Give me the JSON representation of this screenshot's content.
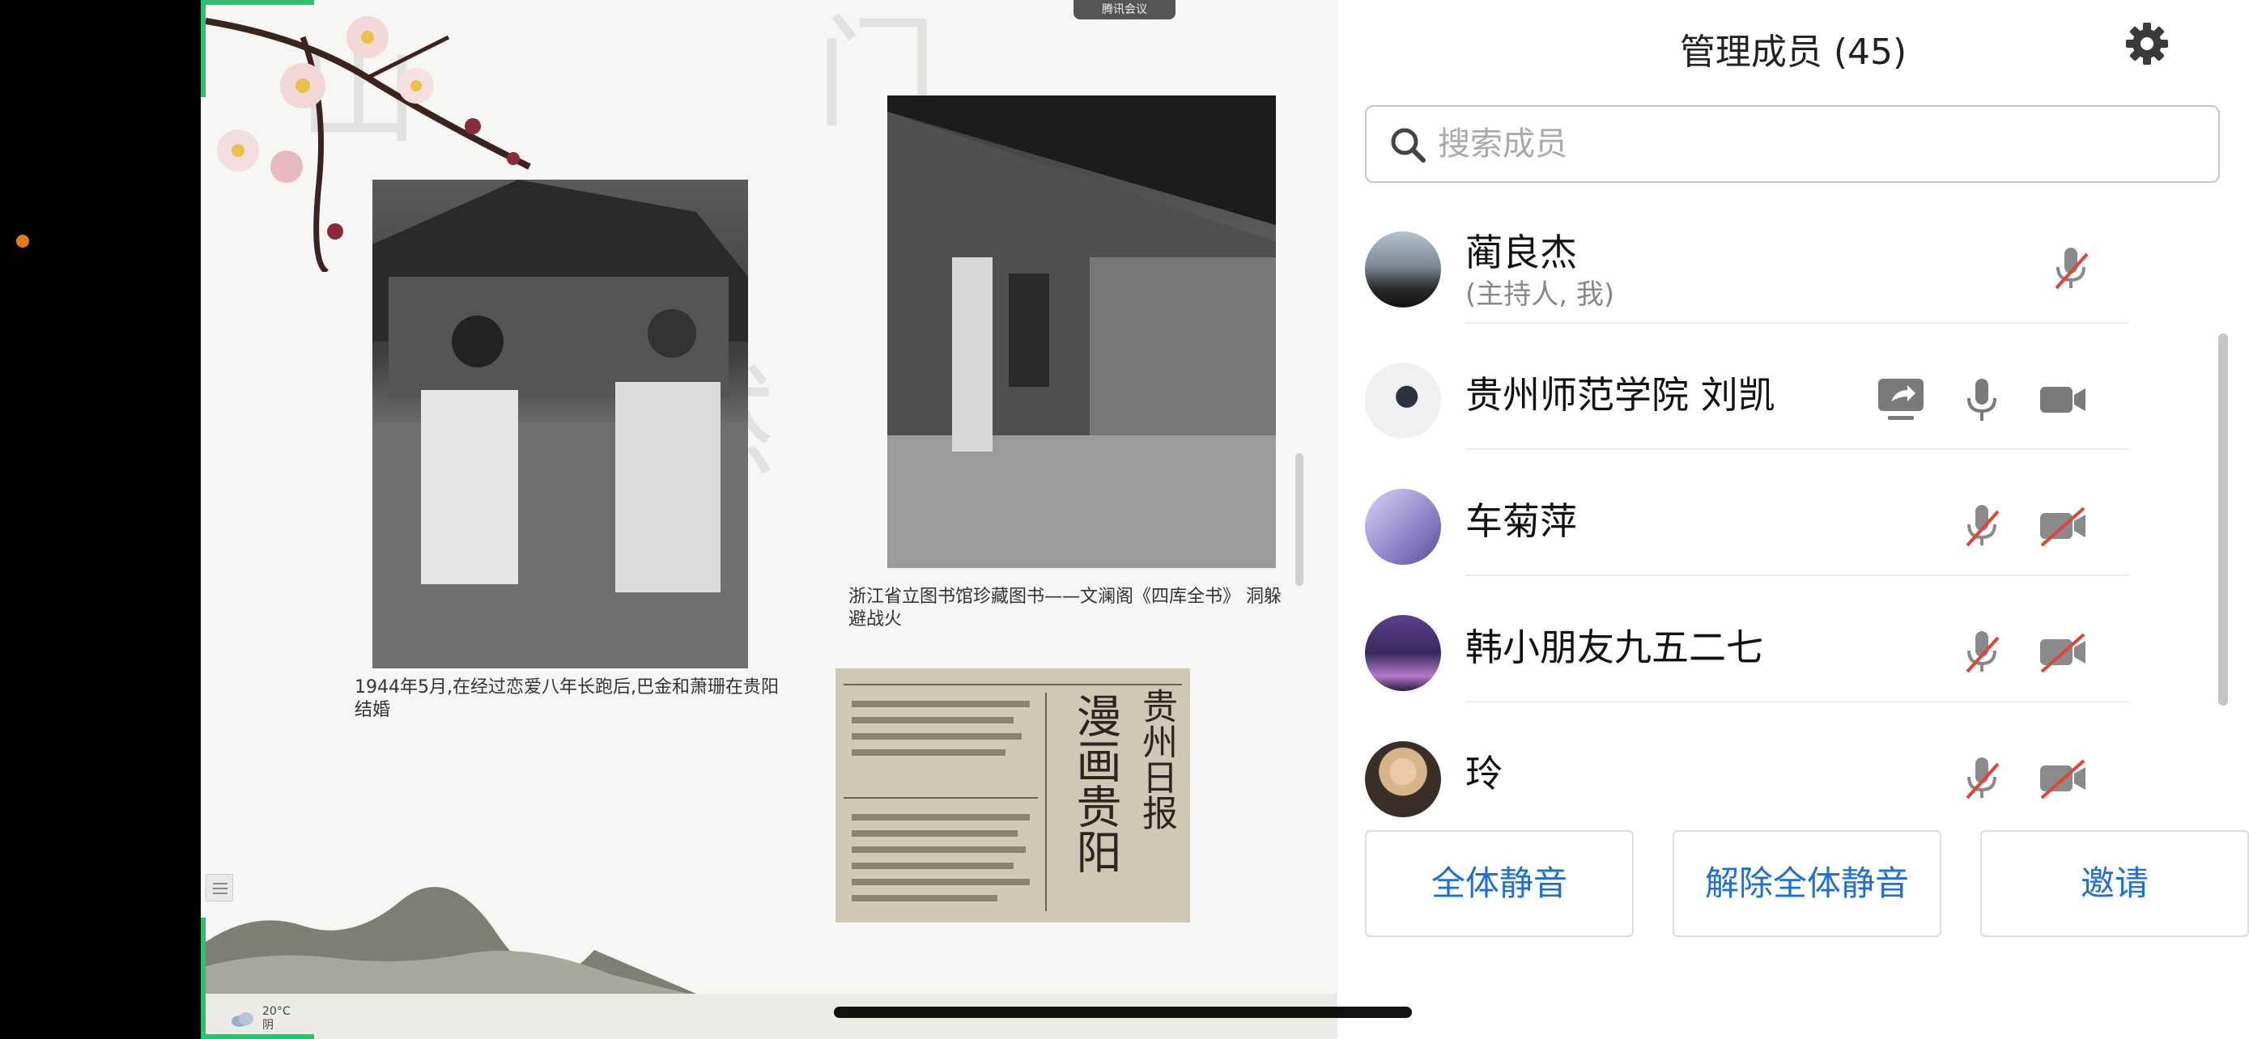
{
  "shared_screen": {
    "meeting_pill": "腾讯会议",
    "caption_1": "1944年5月,在经过恋爱八年长跑后,巴金和萧珊在贵阳结婚",
    "caption_2": "浙江省立图书馆珍藏图书——文澜阁《四库全书》 洞躲避战火",
    "newspaper_title": "贵州日报",
    "newspaper_headline": "漫画贵阳",
    "weather_temp": "20°C",
    "weather_desc": "阴"
  },
  "panel": {
    "title": "管理成员 (45)",
    "search_placeholder": "搜索成员",
    "members": [
      {
        "name": "蔺良杰",
        "role": "(主持人, 我)",
        "mic": "muted",
        "camera": "none",
        "share": false
      },
      {
        "name": "贵州师范学院 刘凯",
        "role": "",
        "mic": "on",
        "camera": "on",
        "share": true
      },
      {
        "name": "车菊萍",
        "role": "",
        "mic": "muted",
        "camera": "off",
        "share": false
      },
      {
        "name": "韩小朋友九五二七",
        "role": "",
        "mic": "muted",
        "camera": "off",
        "share": false
      },
      {
        "name": "玲",
        "role": "",
        "mic": "muted",
        "camera": "off",
        "share": false
      }
    ],
    "buttons": {
      "mute_all": "全体静音",
      "unmute_all": "解除全体静音",
      "invite": "邀请"
    }
  },
  "colors": {
    "accent_blue": "#1f6fd9",
    "share_border_green": "#2fbf71",
    "muted_red": "#e0443a",
    "icon_gray": "#7a7a7a"
  }
}
